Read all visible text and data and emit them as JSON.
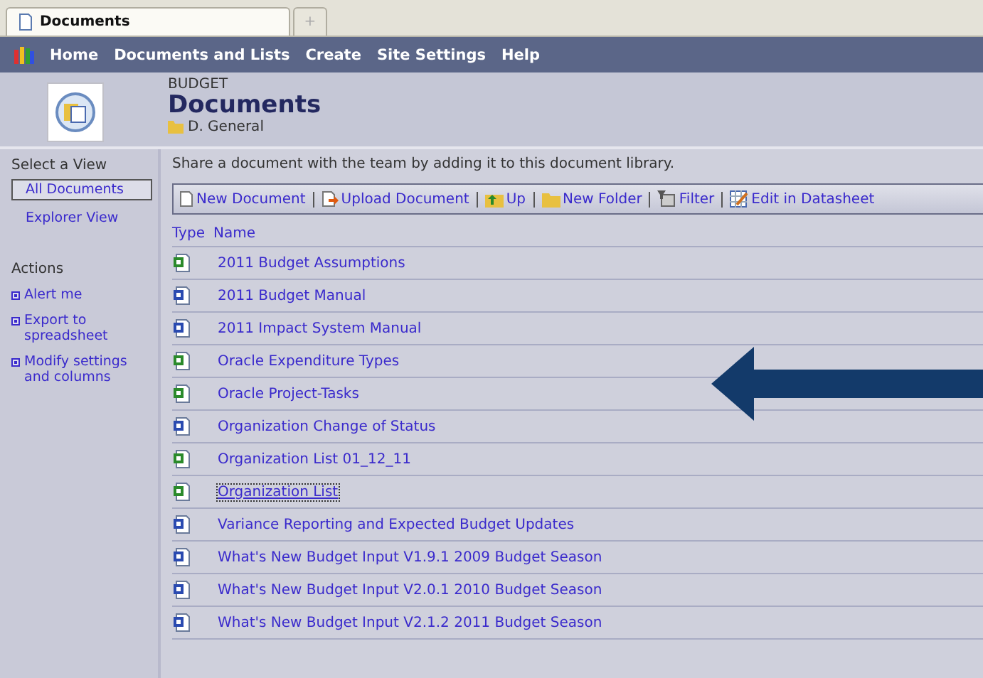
{
  "browser_tabs": [
    {
      "label": "Documents",
      "selected": true
    },
    {
      "label": "+",
      "selected": false
    }
  ],
  "nav": [
    "Home",
    "Documents and Lists",
    "Create",
    "Site Settings",
    "Help"
  ],
  "header": {
    "site": "BUDGET",
    "title": "Documents",
    "folder": "D. General"
  },
  "sidebar": {
    "views_title": "Select a View",
    "views": [
      {
        "label": "All Documents",
        "selected": true
      },
      {
        "label": "Explorer View",
        "selected": false
      }
    ],
    "actions_title": "Actions",
    "actions": [
      "Alert me",
      "Export to spreadsheet",
      "Modify settings and columns"
    ]
  },
  "description": "Share a document with the team by adding it to this document library.",
  "toolbar": [
    {
      "label": "New Document",
      "kind": "new"
    },
    {
      "label": "Upload Document",
      "kind": "upload"
    },
    {
      "label": "Up",
      "kind": "up"
    },
    {
      "label": "New Folder",
      "kind": "folder"
    },
    {
      "label": "Filter",
      "kind": "filter"
    },
    {
      "label": "Edit in Datasheet",
      "kind": "datasheet"
    }
  ],
  "columns": [
    "Type",
    "Name"
  ],
  "rows": [
    {
      "kind": "excel",
      "name": "2011 Budget Assumptions",
      "focused": false
    },
    {
      "kind": "word",
      "name": "2011 Budget Manual",
      "focused": false
    },
    {
      "kind": "word",
      "name": "2011 Impact System Manual",
      "focused": false
    },
    {
      "kind": "excel",
      "name": "Oracle Expenditure Types",
      "focused": false
    },
    {
      "kind": "excel",
      "name": "Oracle Project-Tasks",
      "focused": false
    },
    {
      "kind": "word",
      "name": "Organization Change of Status",
      "focused": false
    },
    {
      "kind": "excel",
      "name": "Organization List 01_12_11",
      "focused": false
    },
    {
      "kind": "excel",
      "name": "Organization List",
      "focused": true
    },
    {
      "kind": "word",
      "name": "Variance Reporting and Expected Budget Updates",
      "focused": false
    },
    {
      "kind": "word",
      "name": "What's New Budget Input V1.9.1 2009 Budget Season",
      "focused": false
    },
    {
      "kind": "word",
      "name": "What's New Budget Input V2.0.1 2010 Budget Season",
      "focused": false
    },
    {
      "kind": "word",
      "name": "What's New Budget Input V2.1.2 2011 Budget Season",
      "focused": false
    }
  ]
}
